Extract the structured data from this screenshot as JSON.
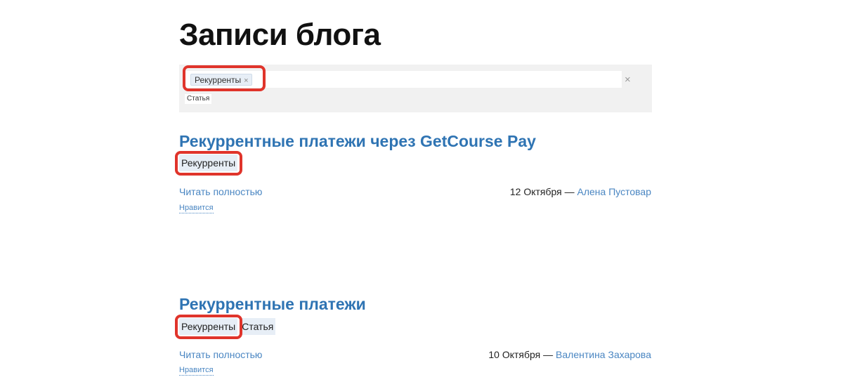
{
  "page": {
    "title": "Записи блога"
  },
  "filter": {
    "selected_tag": "Рекурренты",
    "remove_glyph": "×",
    "clear_glyph": "×",
    "available_tag": "Статья"
  },
  "posts": [
    {
      "title": "Рекуррентные платежи через GetCourse Pay",
      "tags": [
        "Рекурренты"
      ],
      "read_more": "Читать полностью",
      "date": "12 Октября",
      "separator": " — ",
      "author": "Алена Пустовар",
      "like": "Нравится"
    },
    {
      "title": "Рекуррентные платежи",
      "tags": [
        "Рекурренты",
        "Статья"
      ],
      "read_more": "Читать полностью",
      "date": "10 Октября",
      "separator": " — ",
      "author": "Валентина Захарова",
      "like": "Нравится"
    }
  ],
  "colors": {
    "link": "#2f74b3",
    "highlight": "#e0342b",
    "tag_bg": "#e7eef6",
    "panel_bg": "#f1f1f1"
  }
}
